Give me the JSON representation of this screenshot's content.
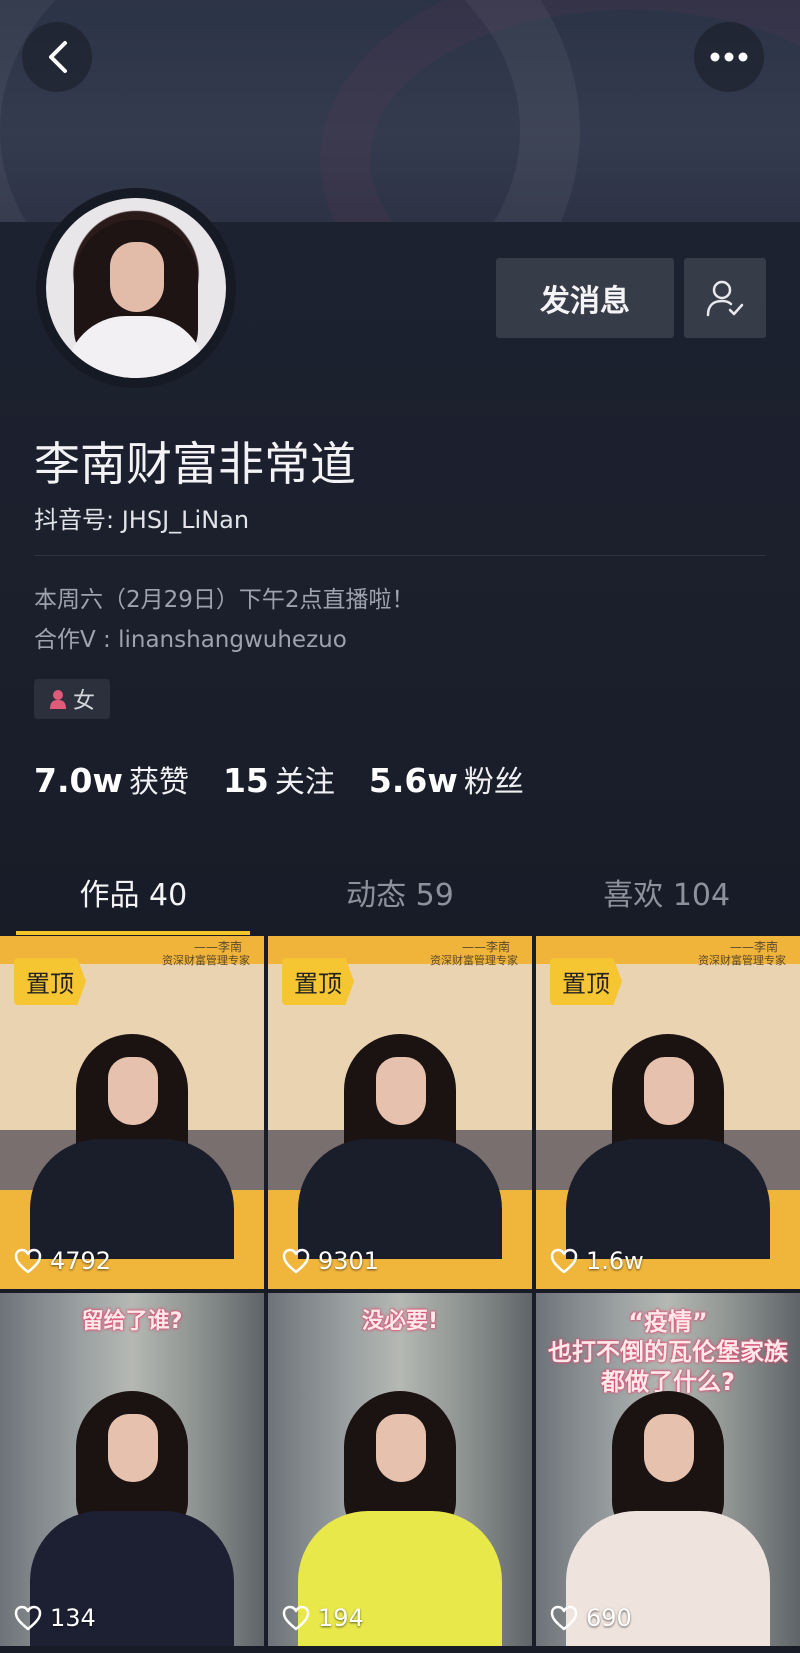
{
  "header": {
    "back_icon": "chevron-left-icon",
    "more_icon": "more-dots-icon"
  },
  "profile": {
    "message_button": "发消息",
    "name": "李南财富非常道",
    "douyin_id": "抖音号: JHSJ_LiNan",
    "bio_line1": "本周六（2月29日）下午2点直播啦！",
    "bio_line2": "合作V : linanshangwuhezuo",
    "gender": "女",
    "stats": [
      {
        "num": "7.0w",
        "label": "获赞"
      },
      {
        "num": "15",
        "label": "关注"
      },
      {
        "num": "5.6w",
        "label": "粉丝"
      }
    ]
  },
  "tabs": [
    {
      "label": "作品 40",
      "active": true
    },
    {
      "label": "动态 59",
      "active": false
    },
    {
      "label": "喜欢 104",
      "active": false
    }
  ],
  "videos": [
    {
      "pinned_label": "置顶",
      "likes": "4792",
      "overlay": ""
    },
    {
      "pinned_label": "置顶",
      "likes": "9301",
      "overlay": ""
    },
    {
      "pinned_label": "置顶",
      "likes": "1.6w",
      "overlay": ""
    },
    {
      "pinned_label": "",
      "likes": "134",
      "overlay": "留给了谁?"
    },
    {
      "pinned_label": "",
      "likes": "194",
      "overlay": "没必要!"
    },
    {
      "pinned_label": "",
      "likes": "690",
      "overlay": "“疫情”\n也打不倒的瓦伦堡家族\n都做了什么?"
    }
  ],
  "watermark": {
    "line1": "——李南",
    "line2": "资深财富管理专家"
  },
  "colors": {
    "accent": "#f3c528",
    "background": "#181c27",
    "button": "#373c49"
  }
}
